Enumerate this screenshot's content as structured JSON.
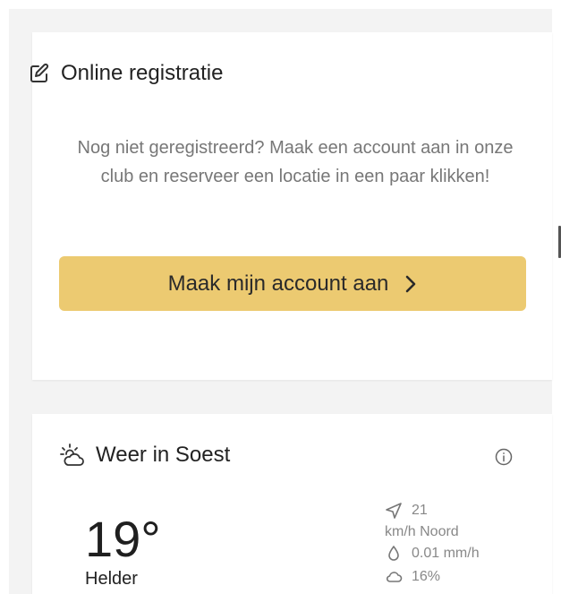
{
  "colors": {
    "accent": "#ecca71",
    "muted_text": "#777777",
    "title_text": "#222222",
    "stat_text": "#888888",
    "background": "#f3f3f3"
  },
  "registration": {
    "icon": "edit-icon",
    "title": "Online registratie",
    "description": "Nog niet geregistreerd? Maak een account aan in onze club en reserveer een locatie in een paar klikken!",
    "button_label": "Maak mijn account aan",
    "button_icon": "chevron-right-icon"
  },
  "weather": {
    "icon": "sun-cloud-icon",
    "title": "Weer in Soest",
    "info_icon": "info-icon",
    "temperature": "19°",
    "condition": "Helder",
    "wind_speed": "21",
    "wind_unit": "km/h Noord",
    "precipitation": "0.01 mm/h",
    "cloud_cover": "16%"
  }
}
